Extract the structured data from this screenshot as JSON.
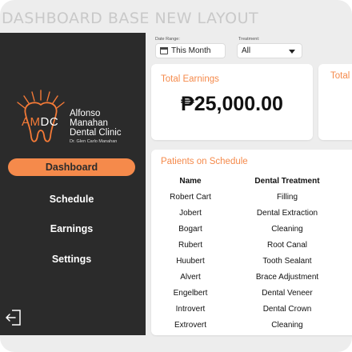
{
  "banner_title": "DASHBOARD BASE NEW LAYOUT",
  "clinic": {
    "name": "Alfonso\nManahan\nDental Clinic",
    "doctor": "Dr. Glen Carlo Manahan",
    "logo_am": "AM",
    "logo_dc": "DC"
  },
  "nav": {
    "items": [
      {
        "label": "Dashboard"
      },
      {
        "label": "Schedule"
      },
      {
        "label": "Earnings"
      },
      {
        "label": "Settings"
      }
    ],
    "active_index": 0
  },
  "filters": {
    "date_range_label": "Date Range:",
    "date_range_value": "This Month",
    "treatment_label": "Treatment:",
    "treatment_value": "All"
  },
  "total_earnings": {
    "title": "Total Earnings",
    "value": "₱25,000.00"
  },
  "second_card_title": "Total",
  "schedule": {
    "title": "Patients on Schedule",
    "columns": [
      "Name",
      "Dental Treatment"
    ],
    "rows": [
      [
        "Robert Cart",
        "Filling"
      ],
      [
        "Jobert",
        "Dental Extraction"
      ],
      [
        "Bogart",
        "Cleaning"
      ],
      [
        "Rubert",
        "Root Canal"
      ],
      [
        "Huubert",
        "Tooth Sealant"
      ],
      [
        "Alvert",
        "Brace Adjustment"
      ],
      [
        "Engelbert",
        "Dental Veneer"
      ],
      [
        "Introvert",
        "Dental Crown"
      ],
      [
        "Extrovert",
        "Cleaning"
      ]
    ]
  },
  "colors": {
    "accent": "#f58a4b",
    "sidebar": "#2b2b2b",
    "background": "#ededed"
  }
}
